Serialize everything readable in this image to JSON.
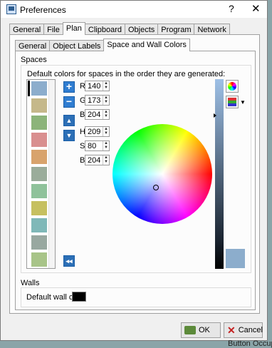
{
  "window": {
    "title": "Preferences",
    "help": "?",
    "close": "✕"
  },
  "main_tabs": [
    "General",
    "File",
    "Plan",
    "Clipboard",
    "Objects",
    "Program",
    "Network"
  ],
  "sub_tabs": [
    "General",
    "Object Labels",
    "Space and Wall Colors"
  ],
  "spaces": {
    "title": "Spaces",
    "subtitle": "Default colors for spaces in the order they are generated:",
    "swatches": [
      "#8cadcc",
      "#c5b88a",
      "#8cb47a",
      "#d98f8f",
      "#d8a36c",
      "#9aac9a",
      "#8fc29a",
      "#c6c060",
      "#7fb8b8",
      "#98a8a0",
      "#a8c488",
      "#d08a78"
    ],
    "buttons": {
      "add": "+",
      "remove": "−",
      "up": "▲",
      "down": "▼",
      "reverse": "◂◂"
    },
    "rgb": {
      "R": "140",
      "G": "173",
      "B": "204"
    },
    "hsb": {
      "H": "209",
      "S": "80",
      "B": "204"
    },
    "selected_color": "#8cadcc"
  },
  "walls": {
    "title": "Walls",
    "label": "Default wall color",
    "color": "#000000"
  },
  "buttons": {
    "ok": "OK",
    "cancel": "Cancel"
  },
  "background_text": "Button Occupan"
}
